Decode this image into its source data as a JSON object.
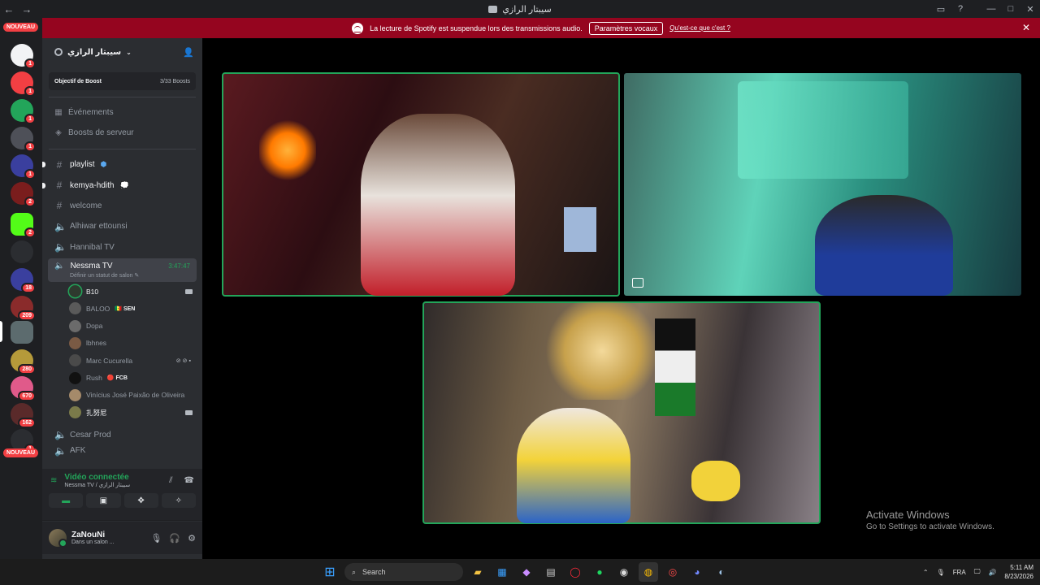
{
  "window": {
    "title": "سيبتار الرازي",
    "back": "←",
    "forward": "→"
  },
  "notice": {
    "text": "La lecture de Spotify est suspendue lors des transmissions audio.",
    "button": "Paramètres vocaux",
    "link": "Qu'est-ce que c'est ?"
  },
  "rail": {
    "nouveau_top": "NOUVEAU",
    "nouveau_bottom": "NOUVEAU",
    "badges": [
      "1",
      "1",
      "1",
      "1",
      "1",
      "2",
      "2",
      "18",
      "209",
      "280",
      "670",
      "162",
      "1"
    ]
  },
  "server": {
    "name": "سيبتار الرازي",
    "boost_label": "Objectif de Boost",
    "boost_value": "3/33 Boosts"
  },
  "nav": {
    "events": "Événements",
    "boosts": "Boosts de serveur"
  },
  "channels": {
    "playlist": "playlist",
    "kemya": "kemya-hdith",
    "welcome": "welcome",
    "alhiwar": "Alhiwar ettounsi",
    "hannibal": "Hannibal TV",
    "nessma": "Nessma TV",
    "nessma_time": "3:47:47",
    "nessma_sub": "Définir un statut de salon",
    "cesar": "Cesar Prod",
    "next": "AFK"
  },
  "members": [
    {
      "name": "B10",
      "tag": ""
    },
    {
      "name": "BALOO",
      "tag": "SEN"
    },
    {
      "name": "Dopa",
      "tag": ""
    },
    {
      "name": "lbhnes",
      "tag": ""
    },
    {
      "name": "Marc Cucurella",
      "tag": ""
    },
    {
      "name": "Rush",
      "tag": "FCB"
    },
    {
      "name": "Vinícius José Paixão de Oliveira",
      "tag": ""
    },
    {
      "name": "扎努尼",
      "tag": ""
    }
  ],
  "voice": {
    "status": "Vidéo connectée",
    "location": "Nessma TV / سيبتار الرازي"
  },
  "user": {
    "name": "ZaNouNi",
    "status": "Dans un salon ..."
  },
  "watermark": {
    "line1": "Activate Windows",
    "line2": "Go to Settings to activate Windows."
  },
  "taskbar": {
    "search": "Search",
    "lang": "FRA",
    "time": "5:11 AM",
    "date": "8/23/2026"
  },
  "colors": {
    "notice": "#95051f",
    "speaking": "#23a55a",
    "accent_red": "#f23f43"
  }
}
